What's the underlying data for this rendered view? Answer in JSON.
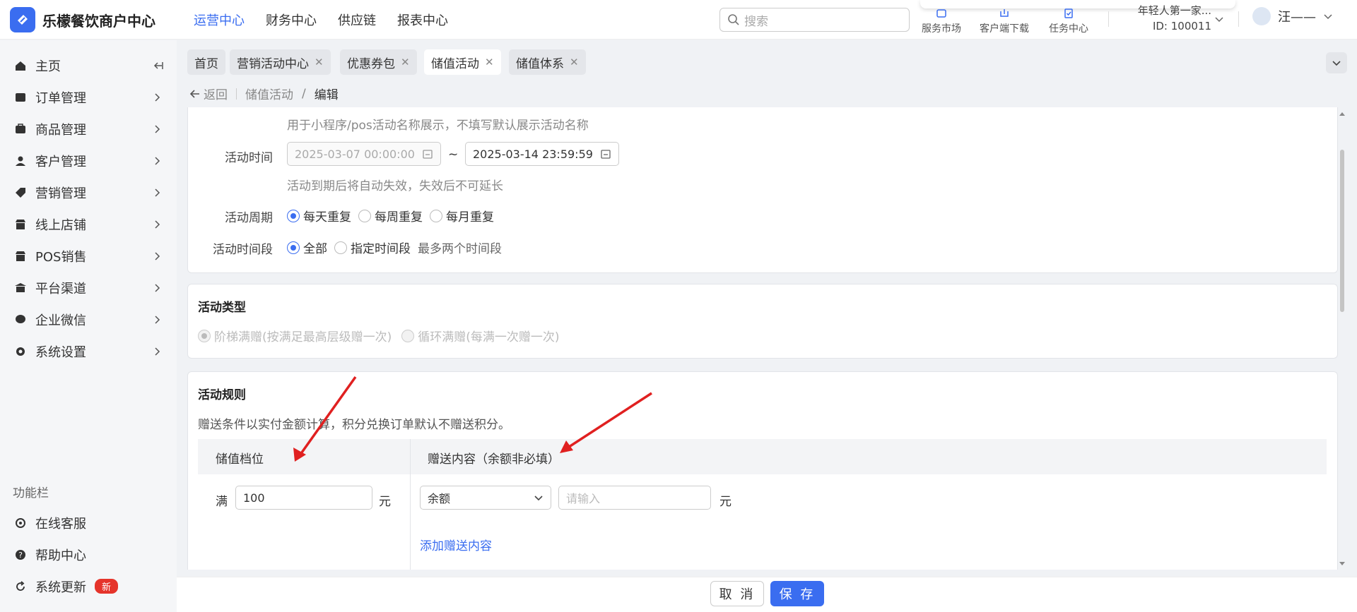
{
  "app": {
    "brand": "乐檬餐饮商户中心"
  },
  "topnav": [
    {
      "label": "运营中心",
      "active": true
    },
    {
      "label": "财务中心"
    },
    {
      "label": "供应链"
    },
    {
      "label": "报表中心"
    }
  ],
  "search": {
    "placeholder": "搜索"
  },
  "tools": [
    {
      "label": "服务市场",
      "icon": "store-icon"
    },
    {
      "label": "客户端下载",
      "icon": "download-icon"
    },
    {
      "label": "任务中心",
      "icon": "task-icon"
    }
  ],
  "store": {
    "name": "年轻人第一家...",
    "id": "ID: 100011"
  },
  "user": {
    "name": "汪——"
  },
  "sidebar": {
    "items": [
      {
        "label": "主页",
        "icon": "home-icon"
      },
      {
        "label": "订单管理",
        "icon": "order-icon"
      },
      {
        "label": "商品管理",
        "icon": "product-icon"
      },
      {
        "label": "客户管理",
        "icon": "user-icon"
      },
      {
        "label": "营销管理",
        "icon": "tag-icon"
      },
      {
        "label": "线上店铺",
        "icon": "shop-icon"
      },
      {
        "label": "POS销售",
        "icon": "pos-icon"
      },
      {
        "label": "平台渠道",
        "icon": "bank-icon"
      },
      {
        "label": "企业微信",
        "icon": "wechat-icon"
      },
      {
        "label": "系统设置",
        "icon": "gear-icon"
      }
    ],
    "section_label": "功能栏",
    "bottom": [
      {
        "label": "在线客服",
        "icon": "headset-icon"
      },
      {
        "label": "帮助中心",
        "icon": "help-icon"
      },
      {
        "label": "系统更新",
        "icon": "refresh-icon",
        "badge": "新"
      }
    ]
  },
  "tabs": [
    {
      "label": "首页",
      "closable": false
    },
    {
      "label": "营销活动中心",
      "closable": true
    },
    {
      "label": "优惠券包",
      "closable": true
    },
    {
      "label": "储值活动",
      "closable": true,
      "active": true
    },
    {
      "label": "储值体系",
      "closable": true
    }
  ],
  "breadcrumb": {
    "back": "返回",
    "parent": "储值活动",
    "sep": "/",
    "current": "编辑"
  },
  "basic": {
    "name_hint": "用于小程序/pos活动名称展示，不填写默认展示活动名称",
    "time_label": "活动时间",
    "start_time": "2025-03-07 00:00:00",
    "tilde": "~",
    "end_time": "2025-03-14 23:59:59",
    "time_hint": "活动到期后将自动失效，失效后不可延长",
    "cycle_label": "活动周期",
    "cycle_options": [
      "每天重复",
      "每周重复",
      "每月重复"
    ],
    "period_label": "活动时间段",
    "period_options": [
      "全部",
      "指定时间段"
    ],
    "period_hint": "最多两个时间段"
  },
  "type": {
    "title": "活动类型",
    "options": [
      "阶梯满赠(按满足最高层级赠一次)",
      "循环满赠(每满一次赠一次)"
    ]
  },
  "rules": {
    "title": "活动规则",
    "desc": "赠送条件以实付金额计算，积分兑换订单默认不赠送积分。",
    "col_tier": "储值档位",
    "col_gift": "赠送内容（余额非必填）",
    "man": "满",
    "amount": "100",
    "unit": "元",
    "gift_type": "余额",
    "gift_placeholder": "请输入",
    "add_gift": "添加赠送内容"
  },
  "footer": {
    "cancel": "取 消",
    "save": "保 存"
  },
  "colors": {
    "primary": "#3a6df0",
    "badge": "#e5342b",
    "arrow": "#e02020"
  }
}
